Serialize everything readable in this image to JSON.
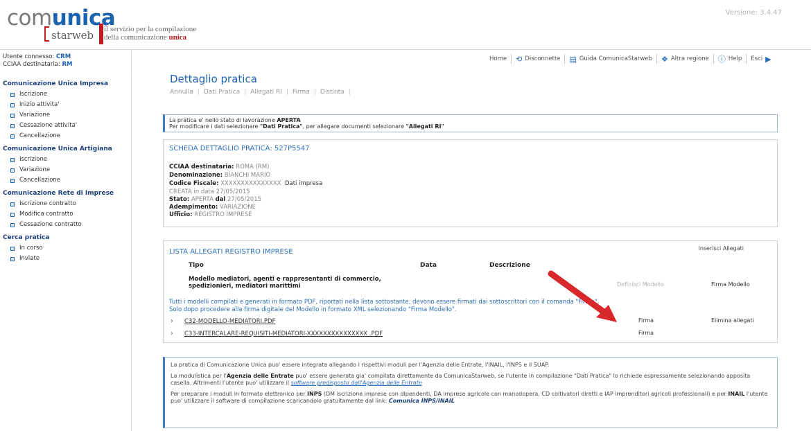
{
  "header": {
    "logo": {
      "word_part1": "com",
      "word_part2": "unica",
      "sub": "starweb"
    },
    "tagline_line1": "il servizio per la compilazione",
    "tagline_line2_pre": "della comunicazione ",
    "tagline_line2_bold": "unica",
    "version": "Versione: 3.4.47"
  },
  "user": {
    "label1": "Utente connesso:",
    "value1": "CRM",
    "label2": "CCIAA destinataria:",
    "value2": "RM"
  },
  "topnav": {
    "home": "Home",
    "disconnect": "Disconnette",
    "guide": "Guida ComunicaStarweb",
    "region": "Altra regione",
    "help": "Help",
    "exit": "Esci"
  },
  "sidebar": {
    "sections": [
      {
        "title": "Comunicazione Unica Impresa",
        "items": [
          "Iscrizione",
          "Inizio attivita'",
          "Variazione",
          "Cessazione attivita'",
          "Cancellazione"
        ]
      },
      {
        "title": "Comunicazione Unica Artigiana",
        "items": [
          "Iscrizione",
          "Variazione",
          "Cancellazione"
        ]
      },
      {
        "title": "Comunicazione Rete di Imprese",
        "items": [
          "Iscrizione contratto",
          "Modifica contratto",
          "Cessazione contratto"
        ]
      },
      {
        "title": "Cerca pratica",
        "items": [
          "In corso",
          "Inviate"
        ]
      }
    ]
  },
  "main": {
    "title": "Dettaglio pratica",
    "tabs": [
      "Annulla",
      "Dati Pratica",
      "Allegati RI",
      "Firma",
      "Distinta"
    ],
    "info_line1_pre": "La pratica e' nello stato di lavorazione ",
    "info_line1_bold": "APERTA",
    "info_line2_pre": "Per modificare i dati selezionare ",
    "info_line2_bold1": "\"Dati Pratica\"",
    "info_line2_mid": ", per allegare documenti selezionare ",
    "info_line2_bold2": "\"Allegati RI\"",
    "scheda": {
      "title": "SCHEDA DETTAGLIO PRATICA: 527P5547",
      "cciaa_label": "CCIAA destinataria:",
      "cciaa_value": "ROMA (RM)",
      "den_label": "Denominazione:",
      "den_value": "BIANCHI MARIO",
      "cf_label": "Codice Fiscale:",
      "cf_value": "XXXXXXXXXXXXXXX",
      "cf_link": "Dati impresa",
      "creata_label": "CREATA in data",
      "creata_value": "27/05/2015",
      "stato_label": "Stato:",
      "stato_value": "APERTA",
      "stato_dal": "dal",
      "stato_date": "27/05/2015",
      "adem_label": "Adempimento:",
      "adem_value": "VARIAZIONE",
      "uff_label": "Ufficio:",
      "uff_value": "REGISTRO IMPRESE"
    },
    "allegati": {
      "title": "LISTA ALLEGATI REGISTRO IMPRESE",
      "insert": "Inserisci Allegati",
      "col_tipo": "Tipo",
      "col_data": "Data",
      "col_desc": "Descrizione",
      "model_line1": "Modello mediatori, agenti e rappresentanti di commercio,",
      "model_line2": "spedizionieri, mediatori marittimi",
      "defmod": "Definisci Modello",
      "firmamod": "Firma Modello",
      "note_line1": "Tutti i modelli compilati e generati in formato PDF, riportati nella lista sottostante, devono essere firmati dai sottoscrittori con il comanda \"Firma\".",
      "note_line2": "Solo dopo procedere alla firma digitale del Modello in formato XML selezionando \"Firma Modello\".",
      "files": [
        {
          "name": "C32-MODELLO-MEDIATORI.PDF",
          "action": "Firma"
        },
        {
          "name": "C33-INTERCALARE-REQUISITI-MEDIATORI-XXXXXXXXXXXXXXX .PDF",
          "action": "Firma"
        }
      ],
      "elimina": "Elimina allegati"
    },
    "bottom": {
      "p1": "La pratica di Comunicazione Unica puo' essere integrata allegando i rispettivi moduli per l'Agenzia delle Entrate, l'INAIL, l'INPS e il SUAP.",
      "p2_pre": "La modulistica per l'",
      "p2_bold": "Agenzia delle Entrate",
      "p2_mid": " puo' essere generata gia' compilata direttamente da ComunicaStarweb, se l'utente in compilazione \"Dati Pratica\" lo richiede espressamente selezionando apposita casella. Altrimenti l'utente puo' utilizzare il ",
      "p2_link": "software predisposto dall'Agenzia delle Entrate",
      "p3_pre": "Per preparare i moduli in formato elettronico per ",
      "p3_bold1": "INPS",
      "p3_mid": " (DM iscrizione imprese con dipendenti, DA imprese agricole con manodopera, CD coltivatori diretti e IAP imprenditori agricoli professionali) e per ",
      "p3_bold2": "INAIL",
      "p3_post": " l'utente puo' utilizzare il software di compilazione scaricandolo gratuitamente dal link: ",
      "p3_link": "Comunica INPS/INAIL"
    }
  },
  "colors": {
    "brand_blue": "#1c63b0",
    "brand_red": "#c4191e",
    "arrow_red": "#d8282b"
  }
}
